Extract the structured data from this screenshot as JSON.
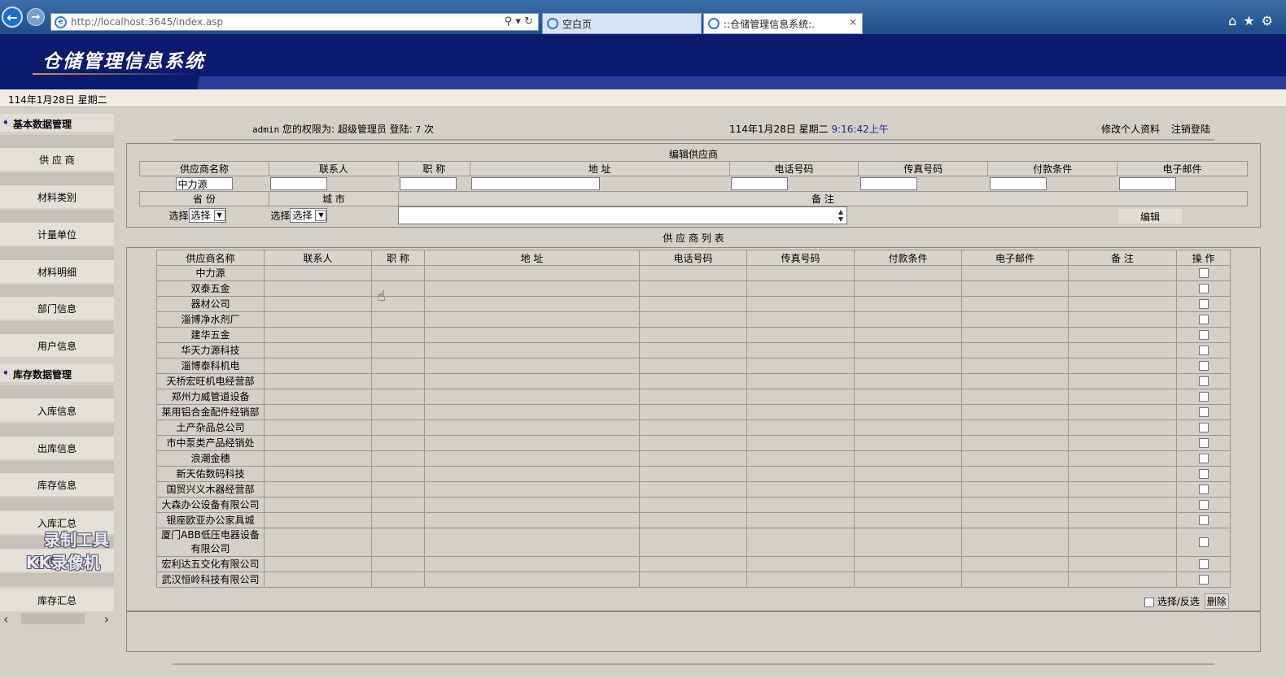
{
  "browser": {
    "url": "http://localhost:3645/index.asp",
    "tab1_title": "空白页",
    "tab2_title": "::仓储管理信息系统:.",
    "tab2_close": "×",
    "back_glyph": "←",
    "fwd_glyph": "→",
    "addr_tools": "⚲ ▾ ↻",
    "right_icons": "⌂★⚙"
  },
  "app": {
    "title": "仓储管理信息系统",
    "date_top": "114年1月28日 星期二"
  },
  "sidebar": {
    "groups": [
      {
        "label": "基本数据管理"
      },
      {
        "label": "库存数据管理"
      }
    ],
    "items": [
      {
        "label": "供 应 商"
      },
      {
        "label": "材料类别"
      },
      {
        "label": "计量单位"
      },
      {
        "label": "材料明细"
      },
      {
        "label": "部门信息"
      },
      {
        "label": "用户信息"
      },
      {
        "label": "入库信息"
      },
      {
        "label": "出库信息"
      },
      {
        "label": "库存信息"
      },
      {
        "label": "入库汇总"
      },
      {
        "label": "出库汇总"
      },
      {
        "label": "库存汇总"
      }
    ],
    "scroll_left": "‹",
    "scroll_right": "›"
  },
  "watermark": {
    "line1": "录制工具",
    "line2": "KK录像机"
  },
  "userbar": {
    "user": "admin",
    "perm_label": "您的权限为:",
    "perm_value": "超级管理员",
    "login_label": "登陆:",
    "login_count": "7",
    "login_unit": "次"
  },
  "clock": {
    "date": "114年1月28日 星期二",
    "time": "9:16:42上午"
  },
  "links": {
    "profile": "修改个人资料",
    "logout": "注销登陆"
  },
  "edit": {
    "title": "编辑供应商",
    "headers": [
      "供应商名称",
      "联系人",
      "职 称",
      "地 址",
      "电话号码",
      "传真号码",
      "付款条件",
      "电子邮件"
    ],
    "name_value": "中力源",
    "province_label": "省 份",
    "city_label": "城 市",
    "note_label": "备 注",
    "choose_label": "选择",
    "select_value": "选择",
    "button": "编辑"
  },
  "list": {
    "title": "供 应 商 列 表",
    "headers": [
      "供应商名称",
      "联系人",
      "职 称",
      "地 址",
      "电话号码",
      "传真号码",
      "付款条件",
      "电子邮件",
      "备 注",
      "操 作"
    ],
    "rows": [
      "中力源",
      "双泰五金",
      "器材公司",
      "淄博净水剂厂",
      "建华五金",
      "华天力源科技",
      "淄博泰科机电",
      "天桥宏旺机电经营部",
      "郑州力威管道设备",
      "莱用铝合金配件经销部",
      "土产杂品总公司",
      "市中泵类产品经销处",
      "浪潮金穗",
      "新天佑数码科技",
      "国贸兴义木器经营部",
      "大森办公设备有限公司",
      "银座欧亚办公家具城",
      "厦门ABB低压电器设备有限公司",
      "宏利达五交化有限公司",
      "武汉恒岭科技有限公司"
    ],
    "select_toggle": "选择/反选",
    "delete": "删除"
  },
  "colors": {
    "header_bg": "#0c1a6e",
    "header_band": "#2d3c9c",
    "page_bg": "#d4d0c8"
  }
}
